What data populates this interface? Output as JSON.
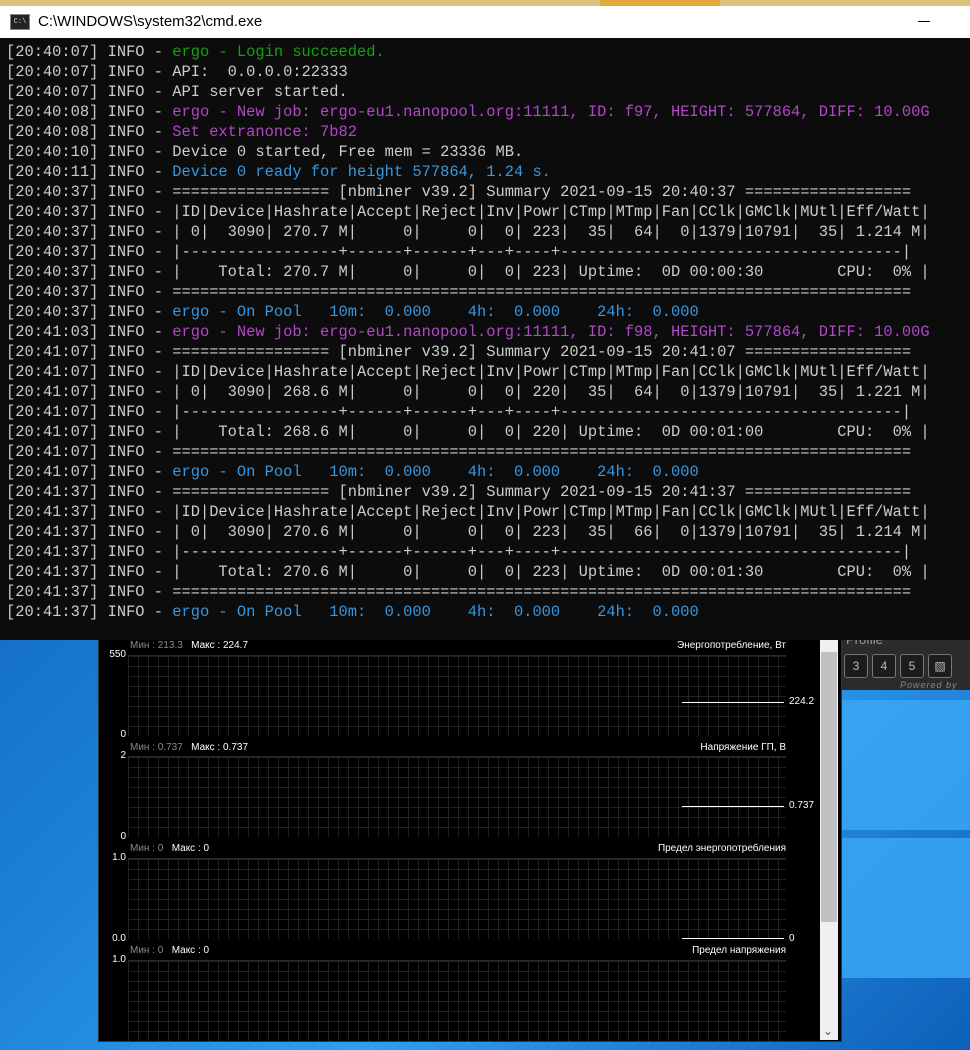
{
  "window": {
    "title": "C:\\WINDOWS\\system32\\cmd.exe",
    "icon": "cmd-icon"
  },
  "console": {
    "lines": [
      {
        "prefix": "[20:40:07] INFO - ",
        "text": "ergo - Login succeeded.",
        "color": "green"
      },
      {
        "prefix": "[20:40:07] INFO - ",
        "text": "API:  0.0.0.0:22333",
        "color": ""
      },
      {
        "prefix": "[20:40:07] INFO - ",
        "text": "API server started.",
        "color": ""
      },
      {
        "prefix": "[20:40:08] INFO - ",
        "text": "ergo - New job: ergo-eu1.nanopool.org:11111, ID: f97, HEIGHT: 577864, DIFF: 10.00G",
        "color": "magenta"
      },
      {
        "prefix": "[20:40:08] INFO - ",
        "text": "Set extranonce: 7b82",
        "color": "magenta"
      },
      {
        "prefix": "[20:40:10] INFO - ",
        "text": "Device 0 started, Free mem = 23336 MB.",
        "color": ""
      },
      {
        "prefix": "[20:40:11] INFO - ",
        "text": "Device 0 ready for height 577864, 1.24 s.",
        "color": "blue"
      },
      {
        "prefix": "[20:40:37] INFO - ",
        "text": "================= [nbminer v39.2] Summary 2021-09-15 20:40:37 ==================",
        "color": ""
      },
      {
        "prefix": "[20:40:37] INFO - ",
        "text": "|ID|Device|Hashrate|Accept|Reject|Inv|Powr|CTmp|MTmp|Fan|CClk|GMClk|MUtl|Eff/Watt|",
        "color": ""
      },
      {
        "prefix": "[20:40:37] INFO - ",
        "text": "| 0|  3090| 270.7 M|     0|     0|  0| 223|  35|  64|  0|1379|10791|  35| 1.214 M|",
        "color": ""
      },
      {
        "prefix": "[20:40:37] INFO - ",
        "text": "|-----------------+------+------+---+----+-------------------------------------|",
        "color": ""
      },
      {
        "prefix": "[20:40:37] INFO - ",
        "text": "|    Total: 270.7 M|     0|     0|  0| 223| Uptime:  0D 00:00:30        CPU:  0% |",
        "color": ""
      },
      {
        "prefix": "[20:40:37] INFO - ",
        "text": "================================================================================",
        "color": ""
      },
      {
        "prefix": "[20:40:37] INFO - ",
        "text": "ergo - On Pool   10m:  0.000    4h:  0.000    24h:  0.000",
        "color": "blue"
      },
      {
        "prefix": "[20:41:03] INFO - ",
        "text": "ergo - New job: ergo-eu1.nanopool.org:11111, ID: f98, HEIGHT: 577864, DIFF: 10.00G",
        "color": "magenta"
      },
      {
        "prefix": "[20:41:07] INFO - ",
        "text": "================= [nbminer v39.2] Summary 2021-09-15 20:41:07 ==================",
        "color": ""
      },
      {
        "prefix": "[20:41:07] INFO - ",
        "text": "|ID|Device|Hashrate|Accept|Reject|Inv|Powr|CTmp|MTmp|Fan|CClk|GMClk|MUtl|Eff/Watt|",
        "color": ""
      },
      {
        "prefix": "[20:41:07] INFO - ",
        "text": "| 0|  3090| 268.6 M|     0|     0|  0| 220|  35|  64|  0|1379|10791|  35| 1.221 M|",
        "color": ""
      },
      {
        "prefix": "[20:41:07] INFO - ",
        "text": "|-----------------+------+------+---+----+-------------------------------------|",
        "color": ""
      },
      {
        "prefix": "[20:41:07] INFO - ",
        "text": "|    Total: 268.6 M|     0|     0|  0| 220| Uptime:  0D 00:01:00        CPU:  0% |",
        "color": ""
      },
      {
        "prefix": "[20:41:07] INFO - ",
        "text": "================================================================================",
        "color": ""
      },
      {
        "prefix": "[20:41:07] INFO - ",
        "text": "ergo - On Pool   10m:  0.000    4h:  0.000    24h:  0.000",
        "color": "blue"
      },
      {
        "prefix": "[20:41:37] INFO - ",
        "text": "================= [nbminer v39.2] Summary 2021-09-15 20:41:37 ==================",
        "color": ""
      },
      {
        "prefix": "[20:41:37] INFO - ",
        "text": "|ID|Device|Hashrate|Accept|Reject|Inv|Powr|CTmp|MTmp|Fan|CClk|GMClk|MUtl|Eff/Watt|",
        "color": ""
      },
      {
        "prefix": "[20:41:37] INFO - ",
        "text": "| 0|  3090| 270.6 M|     0|     0|  0| 223|  35|  66|  0|1379|10791|  35| 1.214 M|",
        "color": ""
      },
      {
        "prefix": "[20:41:37] INFO - ",
        "text": "|-----------------+------+------+---+----+-------------------------------------|",
        "color": ""
      },
      {
        "prefix": "[20:41:37] INFO - ",
        "text": "|    Total: 270.6 M|     0|     0|  0| 223| Uptime:  0D 00:01:30        CPU:  0% |",
        "color": ""
      },
      {
        "prefix": "[20:41:37] INFO - ",
        "text": "================================================================================",
        "color": ""
      },
      {
        "prefix": "[20:41:37] INFO - ",
        "text": "ergo - On Pool   10m:  0.000    4h:  0.000    24h:  0.000",
        "color": "blue"
      }
    ],
    "colors": {
      "green": "#13a10e",
      "magenta": "#b148c6",
      "blue": "#3a96dd",
      "default": "#cccccc"
    }
  },
  "monitor": {
    "profile": {
      "label": "Profile",
      "buttons": [
        "3",
        "4",
        "5"
      ],
      "save_icon": "save-icon",
      "powered": "Powered by"
    },
    "graphs": [
      {
        "min_label": "Мин :",
        "min": "213.3",
        "max_label": "Макс :",
        "max": "224.7",
        "title": "Энергопотребление, Вт",
        "axis_top": "550",
        "axis_bottom": "0",
        "value": "224.2"
      },
      {
        "min_label": "Мин :",
        "min": "0.737",
        "max_label": "Макс :",
        "max": "0.737",
        "title": "Напряжение ГП, В",
        "axis_top": "2",
        "axis_bottom": "0",
        "value": "0.737"
      },
      {
        "min_label": "Мин :",
        "min": "0",
        "max_label": "Макс :",
        "max": "0",
        "title": "Предел энергопотребления",
        "axis_top": "1.0",
        "axis_bottom": "0.0",
        "value": "0"
      },
      {
        "min_label": "Мин :",
        "min": "0",
        "max_label": "Макс :",
        "max": "0",
        "title": "Предел напряжения",
        "axis_top": "1.0",
        "axis_bottom": "",
        "value": ""
      }
    ]
  }
}
